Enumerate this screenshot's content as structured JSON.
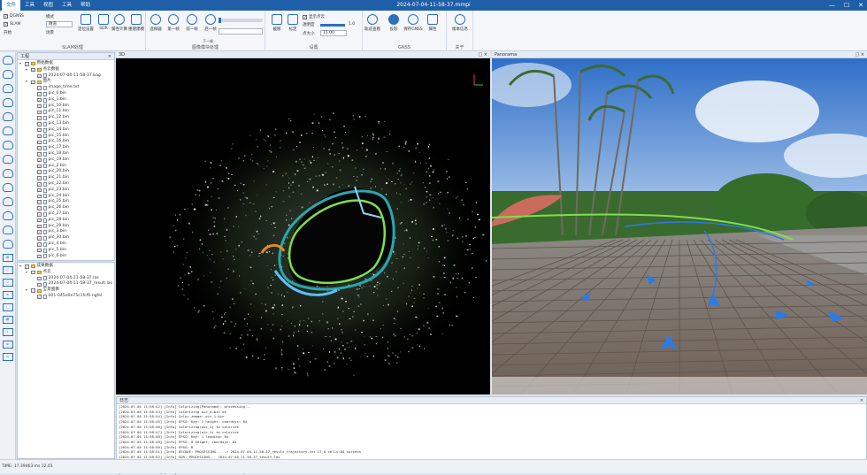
{
  "window": {
    "title": "2024-07-04-11-58-37.mmpi"
  },
  "menu": [
    "文件",
    "工具",
    "视图",
    "工具",
    "帮助"
  ],
  "ribbon": {
    "groups": [
      {
        "title": "SLAM处理"
      },
      {
        "title": "图像模块处理"
      },
      {
        "title": "设置"
      },
      {
        "title": "GNSS"
      },
      {
        "title": "关于"
      }
    ],
    "slam_checks": [
      "DGNSS",
      "SLAM"
    ],
    "slam_labels": [
      "开始",
      "模式",
      "场景"
    ],
    "slam_mode_value": "隧道",
    "slam_buttons": [
      "定位设置",
      "SDR",
      "属性计算",
      "重建建模"
    ],
    "img_buttons": [
      "选择器",
      "第一帧",
      "前一帧",
      "后一帧"
    ],
    "img_second_row_label": "下一帧",
    "settings": {
      "show_label": "显示点云",
      "opacity_label": "透明度",
      "opacity_value": "1.0",
      "size_label": "点大小",
      "size_value": "15.00"
    },
    "settings_buttons": [
      "截图",
      "标定"
    ],
    "gnss_buttons": [
      "轨迹查看",
      "投影",
      "保存GNSS",
      "属性"
    ],
    "about_button": "版本信息"
  },
  "left_panel": {
    "title": "工程",
    "tree1": [
      {
        "label": "原始数据",
        "level": 0,
        "expand": "▾"
      },
      {
        "label": "点云数据",
        "level": 1,
        "expand": "▾"
      },
      {
        "label": "2024-07-04-11-58-37.bag",
        "level": 2,
        "expand": ""
      },
      {
        "label": "图片",
        "level": 1,
        "expand": "▾"
      },
      {
        "label": "image_time.txt",
        "level": 2,
        "expand": ""
      },
      {
        "label": "pic_0.bin",
        "level": 2,
        "expand": ""
      },
      {
        "label": "pic_1.bin",
        "level": 2,
        "expand": ""
      },
      {
        "label": "pic_10.bin",
        "level": 2,
        "expand": ""
      },
      {
        "label": "pic_11.bin",
        "level": 2,
        "expand": ""
      },
      {
        "label": "pic_12.bin",
        "level": 2,
        "expand": ""
      },
      {
        "label": "pic_13.bin",
        "level": 2,
        "expand": ""
      },
      {
        "label": "pic_14.bin",
        "level": 2,
        "expand": ""
      },
      {
        "label": "pic_15.bin",
        "level": 2,
        "expand": ""
      },
      {
        "label": "pic_16.bin",
        "level": 2,
        "expand": ""
      },
      {
        "label": "pic_17.bin",
        "level": 2,
        "expand": ""
      },
      {
        "label": "pic_18.bin",
        "level": 2,
        "expand": ""
      },
      {
        "label": "pic_19.bin",
        "level": 2,
        "expand": ""
      },
      {
        "label": "pic_2.bin",
        "level": 2,
        "expand": ""
      },
      {
        "label": "pic_20.bin",
        "level": 2,
        "expand": ""
      },
      {
        "label": "pic_21.bin",
        "level": 2,
        "expand": ""
      },
      {
        "label": "pic_22.bin",
        "level": 2,
        "expand": ""
      },
      {
        "label": "pic_23.bin",
        "level": 2,
        "expand": ""
      },
      {
        "label": "pic_24.bin",
        "level": 2,
        "expand": ""
      },
      {
        "label": "pic_25.bin",
        "level": 2,
        "expand": ""
      },
      {
        "label": "pic_26.bin",
        "level": 2,
        "expand": ""
      },
      {
        "label": "pic_27.bin",
        "level": 2,
        "expand": ""
      },
      {
        "label": "pic_28.bin",
        "level": 2,
        "expand": ""
      },
      {
        "label": "pic_29.bin",
        "level": 2,
        "expand": ""
      },
      {
        "label": "pic_3.bin",
        "level": 2,
        "expand": ""
      },
      {
        "label": "pic_30.bin",
        "level": 2,
        "expand": ""
      },
      {
        "label": "pic_4.bin",
        "level": 2,
        "expand": ""
      },
      {
        "label": "pic_5.bin",
        "level": 2,
        "expand": ""
      },
      {
        "label": "pic_6.bin",
        "level": 2,
        "expand": ""
      }
    ],
    "tree2": [
      {
        "label": "成果数据",
        "level": 0,
        "expand": "▾"
      },
      {
        "label": "点云",
        "level": 1,
        "expand": "▾"
      },
      {
        "label": "2024-07-04-11-58-37.las",
        "level": 2,
        "expand": ""
      },
      {
        "label": "2024-07-04-11-58-37_result.las",
        "level": 2,
        "expand": ""
      },
      {
        "label": "全景图像",
        "level": 1,
        "expand": "▾"
      },
      {
        "label": "001-045e0e75c1fcf0.ngfel",
        "level": 2,
        "expand": ""
      }
    ]
  },
  "view3d": {
    "title": "3D",
    "axis_label": ""
  },
  "pano": {
    "title": "Panorama"
  },
  "log": {
    "title": "日志",
    "lines": [
      "[2024-07-04 11:58:42] [Info] Colorizing(Panorama): processing...",
      "[2024-07-04 11:58:43] [Info] Colorizing pic_0.bin ok",
      "[2024-07-04 11:58:44] [Info] Color image: pic_1.bin",
      "[2024-07-04 11:58:45] [Info] EPSG: Key: 1 height, coordsys: 84",
      "[2024-07-04 11:58:46] [Info] Colorizing(pic_3) to colorize",
      "[2024-07-04 11:58:47] [Info] Colorizing(pic_4) to colorize",
      "[2024-07-04 11:58:48] [Info] EPSG: Key: 1 loading: 84",
      "[2024-07-04 11:58:49] [Info] EPSG: 8 height, coordsys: 84",
      "[2024-07-04 11:58:50] [Info] EPSG: B",
      "[2024-07-04 11:58:51] [Info] DECODE: PROCESSING... -> 2024-07-04-11-58-37_result_trajectory.txt  LT_0 cells:84  success",
      "[2024-07-04 11:58:52] [Info] SDR: PROCESSING... 2024-07-04-11-58-37_result.las",
      "[2024-07-04 11:58:53] [Info] PROCESSING: SDR ... 2024-07-04-11-58-37_result.las  success",
      "[2024-07-04 11:58:54] [Info] Colorize: PANORAMA ... 2024-07-04-11-58-37_result.las colorized and saved",
      "[2024-07-04 11:58:55] [Info] Colorize: 2024-07-04-11-58-37.ngfel"
    ]
  },
  "status": {
    "text": "TIME: 17.39463 ms  12.01"
  },
  "colors": {
    "accent": "#1f5fa8",
    "traj_blue": "#2c7be5",
    "traj_green": "#7ee04a"
  },
  "icons": [
    "cloud-icon",
    "terminal-icon",
    "gear-icon",
    "camera-icon"
  ]
}
